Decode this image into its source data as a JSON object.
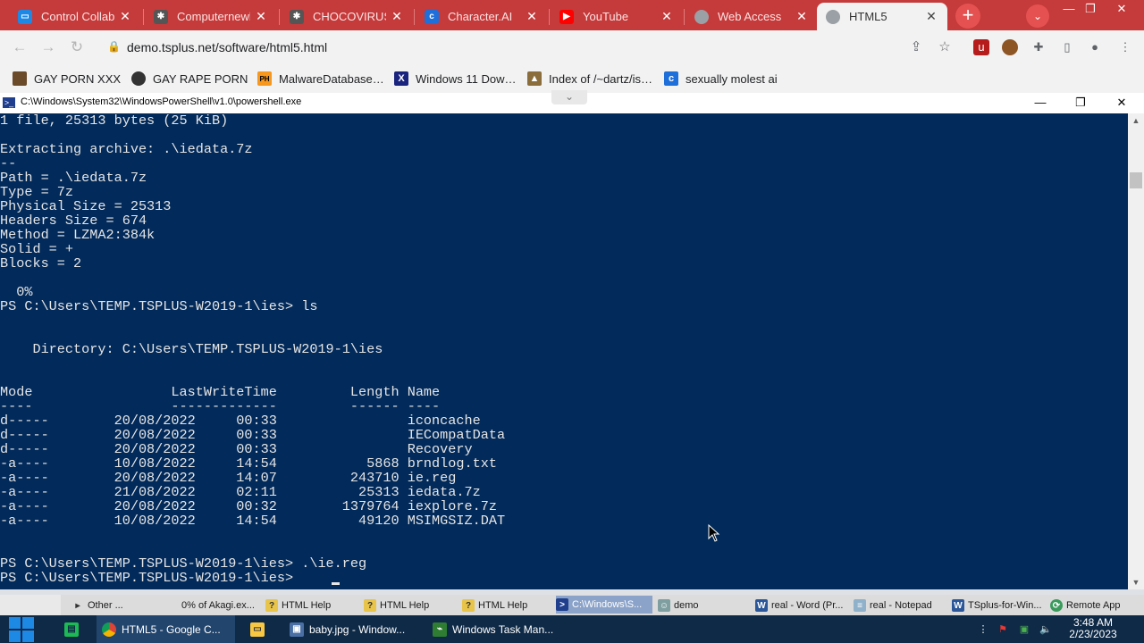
{
  "browser": {
    "tabs": [
      {
        "label": "Control Collab",
        "icon": "monitor-icon",
        "icon_color": "#1e88e5"
      },
      {
        "label": "Computernewb",
        "icon": "virus-icon",
        "icon_color": "#555555"
      },
      {
        "label": "CHOCOVIRUS",
        "icon": "virus-icon",
        "icon_color": "#555555"
      },
      {
        "label": "Character.AI",
        "icon": "character-ai-icon",
        "icon_color": "#1e6fd9"
      },
      {
        "label": "YouTube",
        "icon": "youtube-icon",
        "icon_color": "#ff0000"
      },
      {
        "label": "Web Access",
        "icon": "globe-icon",
        "icon_color": "#9aa0a6"
      },
      {
        "label": "HTML5",
        "icon": "globe-icon",
        "icon_color": "#9aa0a6",
        "active": true
      }
    ],
    "close_glyph": "✕",
    "new_tab_glyph": "+",
    "tab_search_glyph": "⌄",
    "window_controls": [
      "—",
      "❐",
      "✕"
    ],
    "url": "demo.tsplus.net/software/html5.html",
    "bookmarks": [
      {
        "label": "GAY PORN XXX",
        "icon": "bookmark-site-icon",
        "icon_color": "#6b4a2a"
      },
      {
        "label": "GAY RAPE PORN",
        "icon": "bookmark-site-icon",
        "icon_color": "#333333"
      },
      {
        "label": "MalwareDatabase…",
        "icon": "ph-logo-icon",
        "icon_color": "#f7971d"
      },
      {
        "label": "Windows 11 Dow…",
        "icon": "x-logo-icon",
        "icon_color": "#1a237e"
      },
      {
        "label": "Index of /~dartz/is…",
        "icon": "folder-icon",
        "icon_color": "#8a6d3b"
      },
      {
        "label": "sexually molest ai",
        "icon": "character-ai-icon",
        "icon_color": "#1e6fd9"
      }
    ]
  },
  "powershell": {
    "title": "C:\\Windows\\System32\\WindowsPowerShell\\v1.0\\powershell.exe",
    "lines": [
      "1 file, 25313 bytes (25 KiB)",
      "",
      "Extracting archive: .\\iedata.7z",
      "--",
      "Path = .\\iedata.7z",
      "Type = 7z",
      "Physical Size = 25313",
      "Headers Size = 674",
      "Method = LZMA2:384k",
      "Solid = +",
      "Blocks = 2",
      "",
      "  0%",
      "PS C:\\Users\\TEMP.TSPLUS-W2019-1\\ies> ls",
      "",
      "",
      "    Directory: C:\\Users\\TEMP.TSPLUS-W2019-1\\ies",
      "",
      "",
      "Mode                 LastWriteTime         Length Name",
      "----                 -------------         ------ ----",
      "d-----        20/08/2022     00:33                iconcache",
      "d-----        20/08/2022     00:33                IECompatData",
      "d-----        20/08/2022     00:33                Recovery",
      "-a----        10/08/2022     14:54           5868 brndlog.txt",
      "-a----        20/08/2022     14:07         243710 ie.reg",
      "-a----        21/08/2022     02:11          25313 iedata.7z",
      "-a----        20/08/2022     00:32        1379764 iexplore.7z",
      "-a----        10/08/2022     14:54          49120 MSIMGSIZ.DAT",
      "",
      "",
      "PS C:\\Users\\TEMP.TSPLUS-W2019-1\\ies> .\\ie.reg",
      "PS C:\\Users\\TEMP.TSPLUS-W2019-1\\ies> "
    ],
    "background": "#022a5a"
  },
  "remote_taskbar": {
    "items": [
      {
        "label": "Other ...",
        "icon": "triangle-right-icon"
      },
      {
        "label": "0% of Akagi.ex...",
        "icon": "none"
      },
      {
        "label": "HTML Help",
        "icon": "help-icon"
      },
      {
        "label": "HTML Help",
        "icon": "help-icon"
      },
      {
        "label": "HTML Help",
        "icon": "help-icon"
      },
      {
        "label": "C:\\Windows\\S...",
        "icon": "powershell-icon",
        "active": true
      },
      {
        "label": "demo",
        "icon": "user-icon"
      },
      {
        "label": "real - Word (Pr...",
        "icon": "word-icon"
      },
      {
        "label": "real - Notepad",
        "icon": "notepad-icon"
      },
      {
        "label": "TSplus-for-Win...",
        "icon": "word-icon"
      },
      {
        "label": "Remote App",
        "icon": "remote-app-icon"
      }
    ]
  },
  "taskbar": {
    "items": [
      {
        "label": "",
        "icon": "app-green-icon"
      },
      {
        "label": "HTML5 - Google C...",
        "icon": "chrome-icon",
        "active": true
      },
      {
        "label": "",
        "icon": "file-explorer-icon"
      },
      {
        "label": "baby.jpg - Window...",
        "icon": "photo-viewer-icon"
      },
      {
        "label": "Windows Task Man...",
        "icon": "task-manager-icon"
      }
    ],
    "time": "3:48 AM",
    "date": "2/23/2023"
  }
}
